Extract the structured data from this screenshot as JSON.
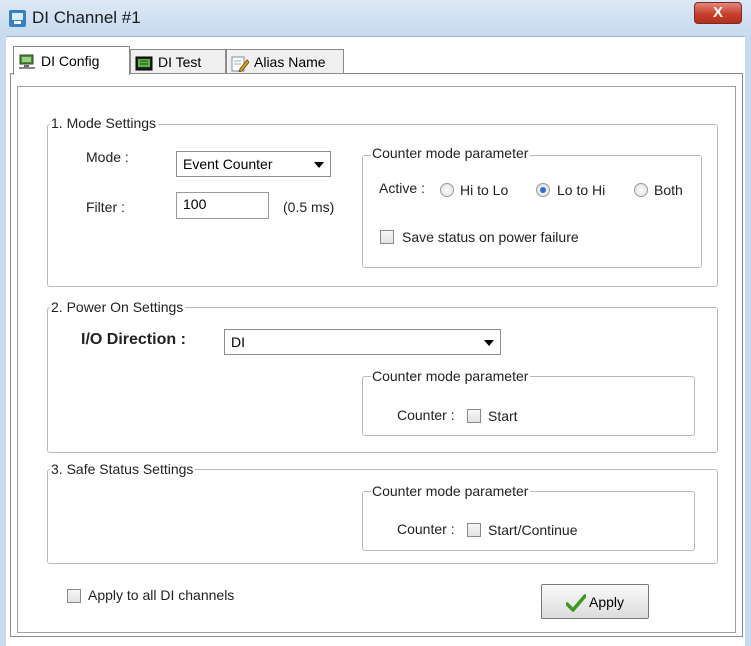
{
  "window": {
    "title": "DI Channel #1",
    "close_glyph": "X",
    "app_icon": "app-icon"
  },
  "tabs": [
    {
      "label": "DI Config",
      "icon": "network-icon",
      "active": true
    },
    {
      "label": "DI Test",
      "icon": "monitor-icon",
      "active": false
    },
    {
      "label": "Alias Name",
      "icon": "edit-pencil-icon",
      "active": false
    }
  ],
  "mode_settings": {
    "legend": "1. Mode Settings",
    "mode_label": "Mode :",
    "mode_value": "Event Counter",
    "filter_label": "Filter :",
    "filter_value": "100",
    "filter_unit": "(0.5 ms)",
    "counter_param": {
      "legend": "Counter mode parameter",
      "active_label": "Active :",
      "options": [
        "Hi to Lo",
        "Lo to Hi",
        "Both"
      ],
      "selected": "Lo to Hi",
      "save_status_label": "Save status on power failure",
      "save_status_checked": false
    }
  },
  "power_on_settings": {
    "legend": "2. Power On Settings",
    "io_direction_label": "I/O Direction :",
    "io_direction_value": "DI",
    "counter_param": {
      "legend": "Counter mode parameter",
      "counter_label": "Counter :",
      "start_label": "Start",
      "start_checked": false
    }
  },
  "safe_status_settings": {
    "legend": "3. Safe Status Settings",
    "counter_param": {
      "legend": "Counter mode parameter",
      "counter_label": "Counter :",
      "start_continue_label": "Start/Continue",
      "start_continue_checked": false
    }
  },
  "footer": {
    "apply_all_label": "Apply to all DI channels",
    "apply_all_checked": false,
    "apply_button_label": "Apply",
    "apply_icon": "checkmark-icon"
  },
  "colors": {
    "title_bar": "#c8daf0",
    "close_button": "#c7402d",
    "radio_selected": "#2d6fd0",
    "checkmark": "#3a9a1e"
  }
}
